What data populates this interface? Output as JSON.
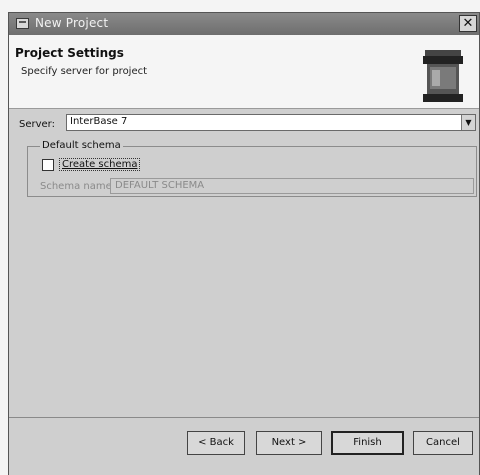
{
  "window": {
    "title": "New Project"
  },
  "header": {
    "title": "Project Settings",
    "subtitle": "Specify server for project"
  },
  "server": {
    "label": "Server:",
    "value": "InterBase 7"
  },
  "default_schema": {
    "legend": "Default schema",
    "create_checkbox_label": "Create schema",
    "create_checked": false,
    "schema_name_label": "Schema name:",
    "schema_name_value": "DEFAULT SCHEMA"
  },
  "buttons": {
    "back": "< Back",
    "next": "Next >",
    "finish": "Finish",
    "cancel": "Cancel"
  },
  "icons": {
    "title": "app-icon",
    "close": "close-icon",
    "header": "database-icon",
    "dropdown": "chevron-down-icon"
  }
}
